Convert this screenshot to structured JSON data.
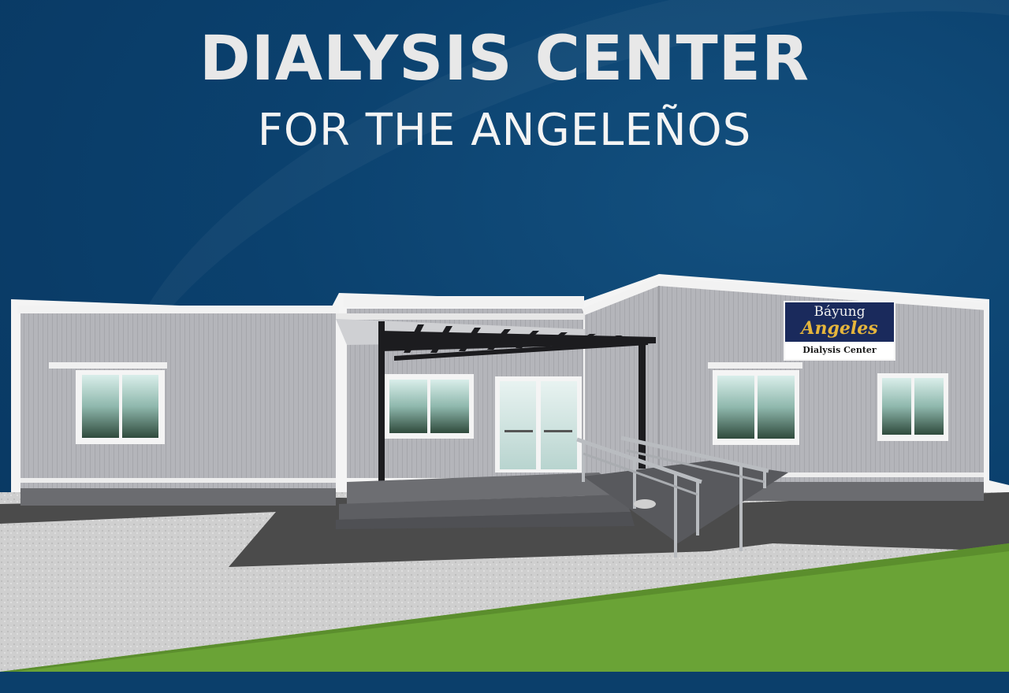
{
  "header": {
    "script_left": "...",
    "script_gold": "",
    "title": "DIALYSIS CENTER",
    "subtitle": "FOR THE ANGELEÑOS"
  },
  "sign": {
    "line1": "Báyung",
    "line2": "Angeles",
    "line3": "Dialysis Center"
  },
  "colors": {
    "background": "#0b3f6b",
    "gold_accent": "#e6b63c",
    "wall": "#b3b4b9",
    "grass": "#6aa336"
  },
  "image_subject": "architectural rendering of a single-storey dialysis center building"
}
